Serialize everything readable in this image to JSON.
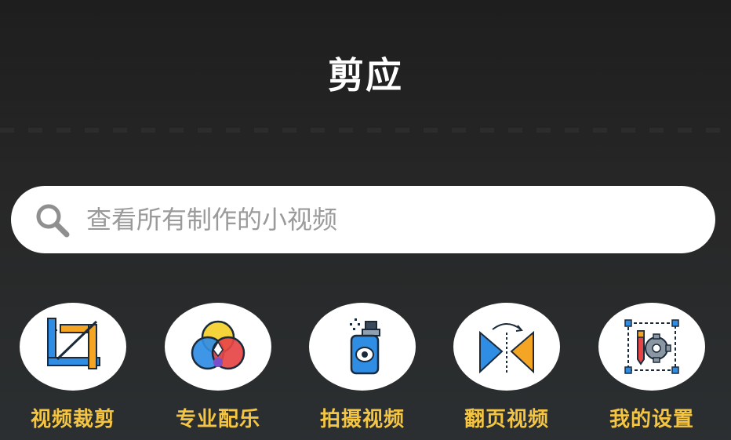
{
  "header": {
    "title": "剪应"
  },
  "search": {
    "placeholder": "查看所有制作的小视频",
    "icon": "search-icon"
  },
  "features": [
    {
      "label": "视频裁剪",
      "icon": "crop-icon"
    },
    {
      "label": "专业配乐",
      "icon": "color-circles-icon"
    },
    {
      "label": "拍摄视频",
      "icon": "camera-spray-icon"
    },
    {
      "label": "翻页视频",
      "icon": "flip-page-icon"
    },
    {
      "label": "我的设置",
      "icon": "settings-gear-icon"
    }
  ],
  "colors": {
    "label_yellow": "#f4c542",
    "accent_blue": "#2f8de4",
    "accent_orange": "#f5a524",
    "accent_red": "#e64545"
  }
}
